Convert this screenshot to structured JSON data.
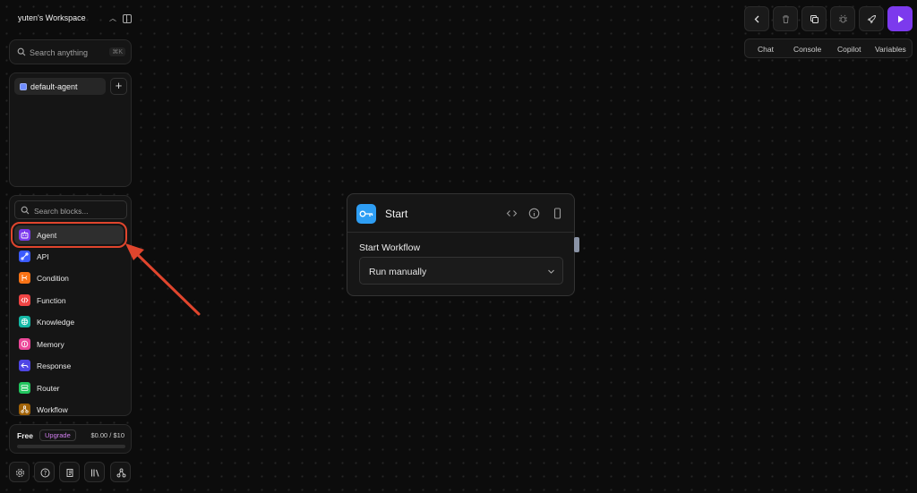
{
  "workspace": {
    "name": "yuten's Workspace"
  },
  "search": {
    "label": "Search anything",
    "shortcut": "⌘K"
  },
  "agents": {
    "items": [
      {
        "label": "default-agent"
      }
    ],
    "add_label": "+"
  },
  "blocks": {
    "search_placeholder": "Search blocks...",
    "items": [
      {
        "label": "Agent",
        "icon": "robot-icon",
        "color": "#7c3aed"
      },
      {
        "label": "API",
        "icon": "link-icon",
        "color": "#3b5bff"
      },
      {
        "label": "Condition",
        "icon": "branch-icon",
        "color": "#f97316"
      },
      {
        "label": "Function",
        "icon": "code-icon",
        "color": "#ef4444"
      },
      {
        "label": "Knowledge",
        "icon": "brain-icon",
        "color": "#14b8a6"
      },
      {
        "label": "Memory",
        "icon": "memory-icon",
        "color": "#ec4899"
      },
      {
        "label": "Response",
        "icon": "reply-icon",
        "color": "#4f46e5"
      },
      {
        "label": "Router",
        "icon": "router-icon",
        "color": "#22c55e"
      },
      {
        "label": "Workflow",
        "icon": "workflow-icon",
        "color": "#a16207"
      }
    ]
  },
  "usage": {
    "plan": "Free",
    "upgrade": "Upgrade",
    "cost": "$0.00 / $10",
    "progress": 0
  },
  "bottom_nav": [
    "settings-icon",
    "help-icon",
    "logs-icon",
    "library-icon",
    "sitemap-icon"
  ],
  "toolbar": {
    "buttons": [
      "back-icon",
      "trash-icon",
      "duplicate-icon",
      "debug-icon",
      "deploy-icon",
      "run-icon"
    ],
    "tabs": [
      "Chat",
      "Console",
      "Copilot",
      "Variables"
    ]
  },
  "node": {
    "title": "Start",
    "field_label": "Start Workflow",
    "select_value": "Run manually",
    "accent": "#2e9ef4"
  },
  "colors": {
    "run_button": "#7c3aed",
    "highlight": "#e0452d",
    "upgrade": "#d27ff0"
  }
}
